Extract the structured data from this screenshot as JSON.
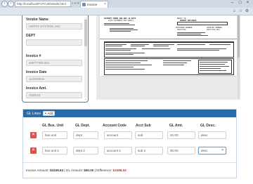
{
  "browser": {
    "address": "http://localhost/FCP/UI/Details.html",
    "tabs": [
      {
        "label": "http://localhost/FC..."
      },
      {
        "label": "Invoice"
      }
    ],
    "window_controls": [
      "–",
      "□",
      "×"
    ],
    "toolbar_icons": [
      "⌂",
      "☆",
      "⚙"
    ]
  },
  "vendor": {
    "fields": [
      {
        "label": "Vendor Name",
        "value": "HERTZ SYSTEM, INC"
      },
      {
        "label": "DEPT",
        "value": ""
      },
      {
        "label": "Invoice #",
        "value": "26977780-004"
      },
      {
        "label": "Invoice Date",
        "value": "11/20/2015"
      },
      {
        "label": "Invoice Amt.",
        "value": "3438.63"
      }
    ]
  },
  "document": {
    "header_left": "PAYMENT TERMS ARE NET 10 DAYS",
    "header_left2": "LATE PAYMENTS MAY APPLY",
    "remit": "REMIT TO",
    "amount_label": "AMOUNT ENCLOSED",
    "customer_label": "CUSTOMER NUMBER",
    "invoice_label": "INVOICE NUMBER",
    "customer_number": "26977780",
    "invoice_number": "26977780-004"
  },
  "gl": {
    "title": "GL Lines",
    "add_label": "Add",
    "columns": [
      "GL Bus. Unit",
      "GL Dept.",
      "Account Code",
      "Acct Sub",
      "GL Amt.",
      "GL Desc."
    ],
    "rows": [
      {
        "bus_unit": "bus unit",
        "dept": "dept",
        "account": "account",
        "sub": "sub",
        "amount": "20.00",
        "desc": "desc"
      },
      {
        "bus_unit": "bus unit 2",
        "dept": "dept 2",
        "account": "account 2",
        "sub": "sub 2",
        "amount": "30.00",
        "desc": "desc"
      }
    ],
    "footer": {
      "invoice_amount_label": "Invoice Amount:",
      "invoice_amount": "$3438.63",
      "gl_amount_label": "GL Amount:",
      "gl_amount": "$50.00",
      "difference_label": "Difference:",
      "difference": "$3388.63",
      "separator": "|"
    }
  },
  "colors": {
    "accent": "#2a6aa8",
    "danger": "#d9534f",
    "panel_border": "#3b7fc3"
  }
}
